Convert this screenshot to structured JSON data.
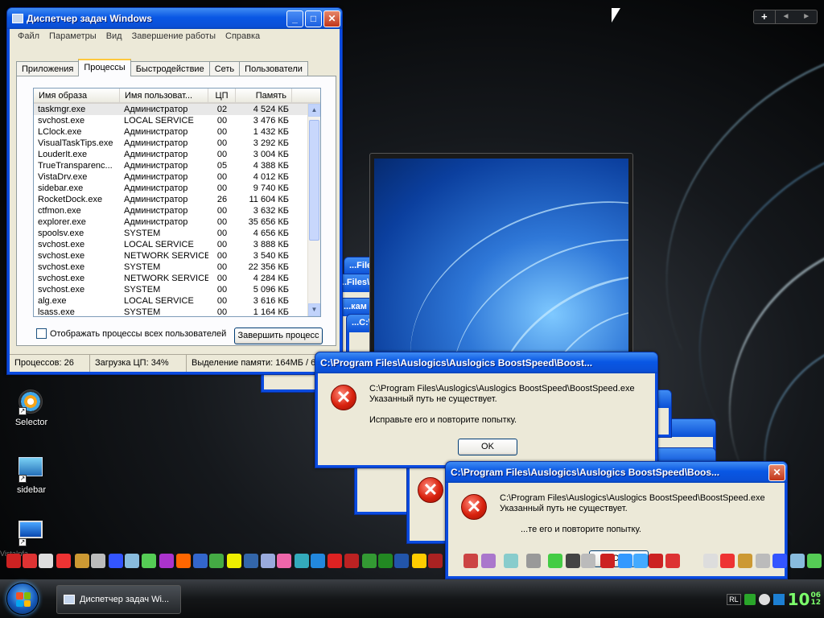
{
  "desktop": {
    "icons": [
      {
        "label": "Selector",
        "icon": "windows-orb-icon"
      },
      {
        "label": "sidebar",
        "icon": "sidebar-gadget-icon"
      },
      {
        "label": "",
        "icon": "monitor-shortcut-icon"
      }
    ],
    "watermark": "VistaInfa",
    "desktop_switch": {
      "add": "+",
      "prev": "◄",
      "next": "►"
    }
  },
  "taskmgr": {
    "title": "Диспетчер задач Windows",
    "menu": [
      "Файл",
      "Параметры",
      "Вид",
      "Завершение работы",
      "Справка"
    ],
    "tabs": [
      "Приложения",
      "Процессы",
      "Быстродействие",
      "Сеть",
      "Пользователи"
    ],
    "active_tab": "Процессы",
    "columns": [
      "Имя образа",
      "Имя пользоват...",
      "ЦП",
      "Память"
    ],
    "rows": [
      {
        "name": "taskmgr.exe",
        "user": "Администратор",
        "cpu": "02",
        "mem": "4 524 КБ"
      },
      {
        "name": "svchost.exe",
        "user": "LOCAL SERVICE",
        "cpu": "00",
        "mem": "3 476 КБ"
      },
      {
        "name": "LClock.exe",
        "user": "Администратор",
        "cpu": "00",
        "mem": "1 432 КБ"
      },
      {
        "name": "VisualTaskTips.exe",
        "user": "Администратор",
        "cpu": "00",
        "mem": "3 292 КБ"
      },
      {
        "name": "LouderIt.exe",
        "user": "Администратор",
        "cpu": "00",
        "mem": "3 004 КБ"
      },
      {
        "name": "TrueTransparenc...",
        "user": "Администратор",
        "cpu": "05",
        "mem": "4 388 КБ"
      },
      {
        "name": "VistaDrv.exe",
        "user": "Администратор",
        "cpu": "00",
        "mem": "4 012 КБ"
      },
      {
        "name": "sidebar.exe",
        "user": "Администратор",
        "cpu": "00",
        "mem": "9 740 КБ"
      },
      {
        "name": "RocketDock.exe",
        "user": "Администратор",
        "cpu": "26",
        "mem": "11 604 КБ"
      },
      {
        "name": "ctfmon.exe",
        "user": "Администратор",
        "cpu": "00",
        "mem": "3 632 КБ"
      },
      {
        "name": "explorer.exe",
        "user": "Администратор",
        "cpu": "00",
        "mem": "35 656 КБ"
      },
      {
        "name": "spoolsv.exe",
        "user": "SYSTEM",
        "cpu": "00",
        "mem": "4 656 КБ"
      },
      {
        "name": "svchost.exe",
        "user": "LOCAL SERVICE",
        "cpu": "00",
        "mem": "3 888 КБ"
      },
      {
        "name": "svchost.exe",
        "user": "NETWORK SERVICE",
        "cpu": "00",
        "mem": "3 540 КБ"
      },
      {
        "name": "svchost.exe",
        "user": "SYSTEM",
        "cpu": "00",
        "mem": "22 356 КБ"
      },
      {
        "name": "svchost.exe",
        "user": "NETWORK SERVICE",
        "cpu": "00",
        "mem": "4 284 КБ"
      },
      {
        "name": "svchost.exe",
        "user": "SYSTEM",
        "cpu": "00",
        "mem": "5 096 КБ"
      },
      {
        "name": "alg.exe",
        "user": "LOCAL SERVICE",
        "cpu": "00",
        "mem": "3 616 КБ"
      },
      {
        "name": "lsass.exe",
        "user": "SYSTEM",
        "cpu": "00",
        "mem": "1 164 КБ"
      }
    ],
    "show_all_label": "Отображать процессы всех пользователей",
    "end_process_label": "Завершить процесс",
    "status": {
      "processes": "Процессов: 26",
      "cpu": "Загрузка ЦП: 34%",
      "memory": "Выделение памяти: 164МБ / 6"
    }
  },
  "error_dialog_1": {
    "title": "C:\\Program Files\\Auslogics\\Auslogics BoostSpeed\\Boost...",
    "path": "C:\\Program Files\\Auslogics\\Auslogics BoostSpeed\\BoostSpeed.exe",
    "message": "Указанный путь не существует.",
    "hint": "Исправьте его и повторите попытку.",
    "ok": "OK"
  },
  "error_dialog_2": {
    "title": "C:\\Program Files\\Auslogics\\Auslogics BoostSpeed\\Boos...",
    "path": "C:\\Program Files\\Auslogics\\Auslogics BoostSpeed\\BoostSpeed.exe",
    "message": "Указанный путь не существует.",
    "hint": "...те его и повторите попытку.",
    "ok": "OK"
  },
  "ghost_titles": {
    "g1": "...Files",
    "g2": "...Files\\A",
    "g3": "...кам Files",
    "g4": "...C:\\P"
  },
  "taskbar": {
    "task_label": "Диспетчер задач Wi...",
    "lang": "RL",
    "clock_hour": "10",
    "clock_min_top": "06",
    "clock_min_bottom": "12"
  },
  "colors": {
    "xp_title": "#0a4be0",
    "dialog_bg": "#ece9d8",
    "clock": "#7cff6b"
  }
}
